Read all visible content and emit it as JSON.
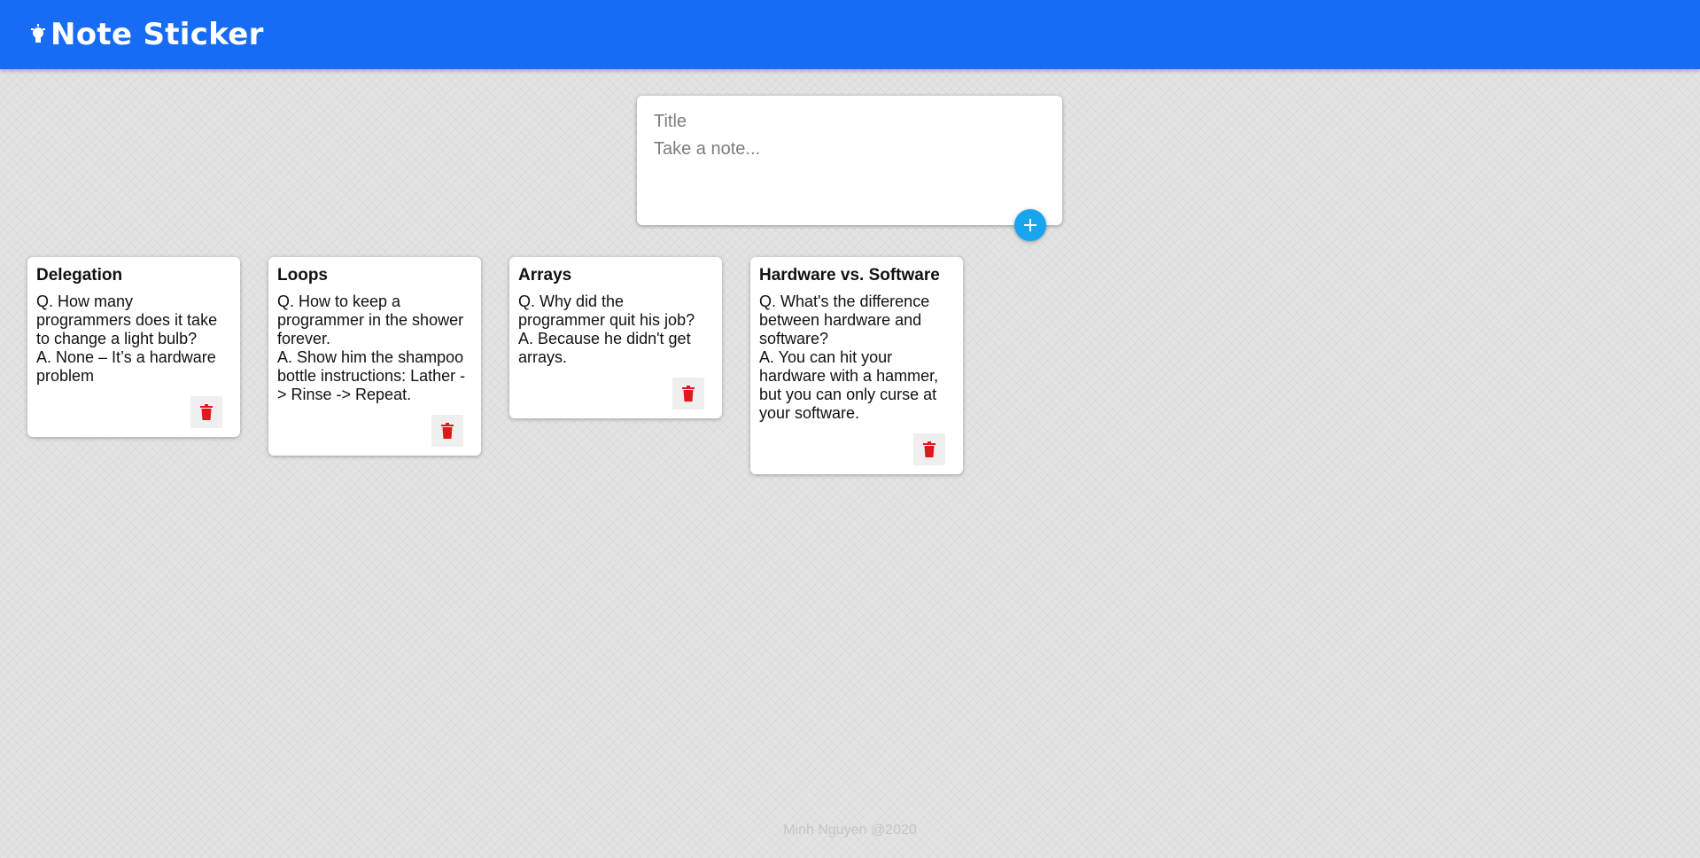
{
  "header": {
    "title": "Note Sticker",
    "logo_icon": "lightbulb-icon",
    "background_color": "#176cf3"
  },
  "composer": {
    "title_placeholder": "Title",
    "content_placeholder": "Take a note...",
    "add_icon": "plus-icon",
    "add_button_color": "#17a5ef"
  },
  "notes": [
    {
      "title": "Delegation",
      "content": "Q. How many programmers does it take to change a light bulb?\nA. None – It’s a hardware problem",
      "delete_icon": "trash-icon"
    },
    {
      "title": "Loops",
      "content": "Q. How to keep a programmer in the shower forever.\nA. Show him the shampoo bottle instructions: Lather -> Rinse -> Repeat.",
      "delete_icon": "trash-icon"
    },
    {
      "title": "Arrays",
      "content": "Q. Why did the programmer quit his job?\nA. Because he didn't get arrays.",
      "delete_icon": "trash-icon"
    },
    {
      "title": "Hardware vs. Software",
      "content": "Q. What's the difference between hardware and software?\nA. You can hit your hardware with a hammer, but you can only curse at your software.",
      "delete_icon": "trash-icon"
    }
  ],
  "delete_icon_color": "#e0181b",
  "footer": {
    "text": "Minh Nguyen @2020"
  }
}
